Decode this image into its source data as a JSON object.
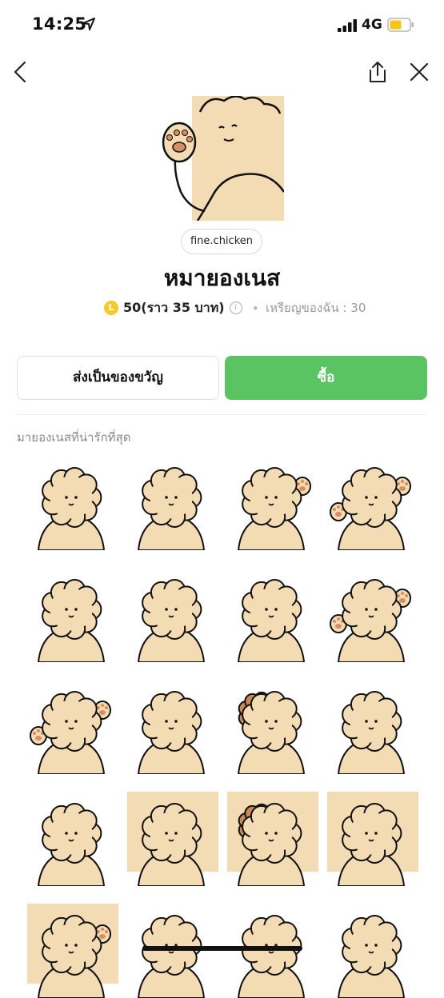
{
  "status_bar": {
    "time": "14:25",
    "network": "4G",
    "icons": [
      "location-arrow-icon",
      "signal-bars-icon",
      "battery-icon"
    ]
  },
  "nav": {
    "icons": [
      "back-chevron-icon",
      "share-icon",
      "close-icon"
    ]
  },
  "product": {
    "author": "fine.chicken",
    "title": "หมายองเนส",
    "price": "50(ราว 35 บาท)",
    "coin_symbol": "L",
    "my_coins": "เหรียญของฉัน : 30",
    "separator": "•"
  },
  "actions": {
    "gift_label": "ส่งเป็นของขวัญ",
    "buy_label": "ซื้อ"
  },
  "description": "มายองเนสที่น่ารักที่สุด",
  "stickers": [
    {
      "name": "hands-on-head"
    },
    {
      "name": "arms-crossed"
    },
    {
      "name": "waving-paw"
    },
    {
      "name": "both-paws-up"
    },
    {
      "name": "hiding-face"
    },
    {
      "name": "smiling-stand"
    },
    {
      "name": "hugging-self"
    },
    {
      "name": "sitting-hug"
    },
    {
      "name": "sitting-paws"
    },
    {
      "name": "covering-mouth"
    },
    {
      "name": "brown-friend-hug"
    },
    {
      "name": "side-glance"
    },
    {
      "name": "thumbs-up"
    },
    {
      "name": "sighing"
    },
    {
      "name": "two-friends-sigh"
    },
    {
      "name": "annoyed"
    },
    {
      "name": "waving-closeup"
    },
    {
      "name": "peeking"
    },
    {
      "name": "looking-up"
    },
    {
      "name": "surprised"
    }
  ],
  "colors": {
    "buy_button": "#5ac463",
    "coin": "#f7c92a",
    "fur": "#f3dcb4",
    "fur_brown": "#c98a55",
    "paw_pad": "#d98d63"
  }
}
